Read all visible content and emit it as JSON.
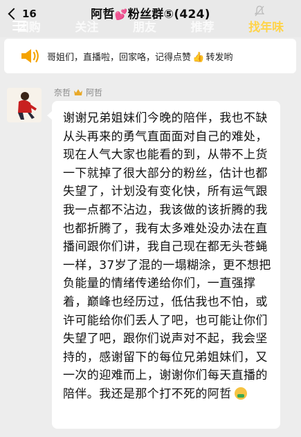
{
  "header": {
    "back_count": "16",
    "title": "阿哲",
    "title_suffix": "粉丝群⑤",
    "title_count": "(424)",
    "tabs": [
      {
        "label": "团购"
      },
      {
        "label": "关注"
      },
      {
        "label": "朋友"
      },
      {
        "label": "推荐"
      },
      {
        "label": "找年味"
      }
    ],
    "active_tab": "找年味"
  },
  "notice": {
    "text_before": "哥姐们，直播啦，回家咯，记得点赞",
    "text_after": "转发哟"
  },
  "message": {
    "sender_name": "奈哲",
    "sender_tag": "阿哲",
    "text": "谢谢兄弟姐妹们今晚的陪伴，我也不缺从头再来的勇气直面面对自己的难处，现在人气大家也能看的到，从带不上货一下就掉了很大部分的粉丝，估计也都失望了，计划没有变化快，所有运气跟我一点都不沾边，我该做的该折腾的我也都折腾了，我有太多难处没办法在直播间跟你们讲，我自己现在都无头苍蝇一样，37岁了混的一塌糊涂，更不想把负能量的情绪传递给你们，一直强撑着，巅峰也经历过，低估我也不怕，或许可能给你们丢人了吧，也可能让你们失望了吧，跟你们说声对不起，我会坚持的，感谢留下的每位兄弟姐妹们，又一次的迎难而上，谢谢你们每天直播的陪伴。我还是那个打不死的阿哲"
  },
  "colors": {
    "accent_tab": "#ffd44a",
    "heart": "#ff4fa3",
    "speaker": "#f5a300"
  }
}
